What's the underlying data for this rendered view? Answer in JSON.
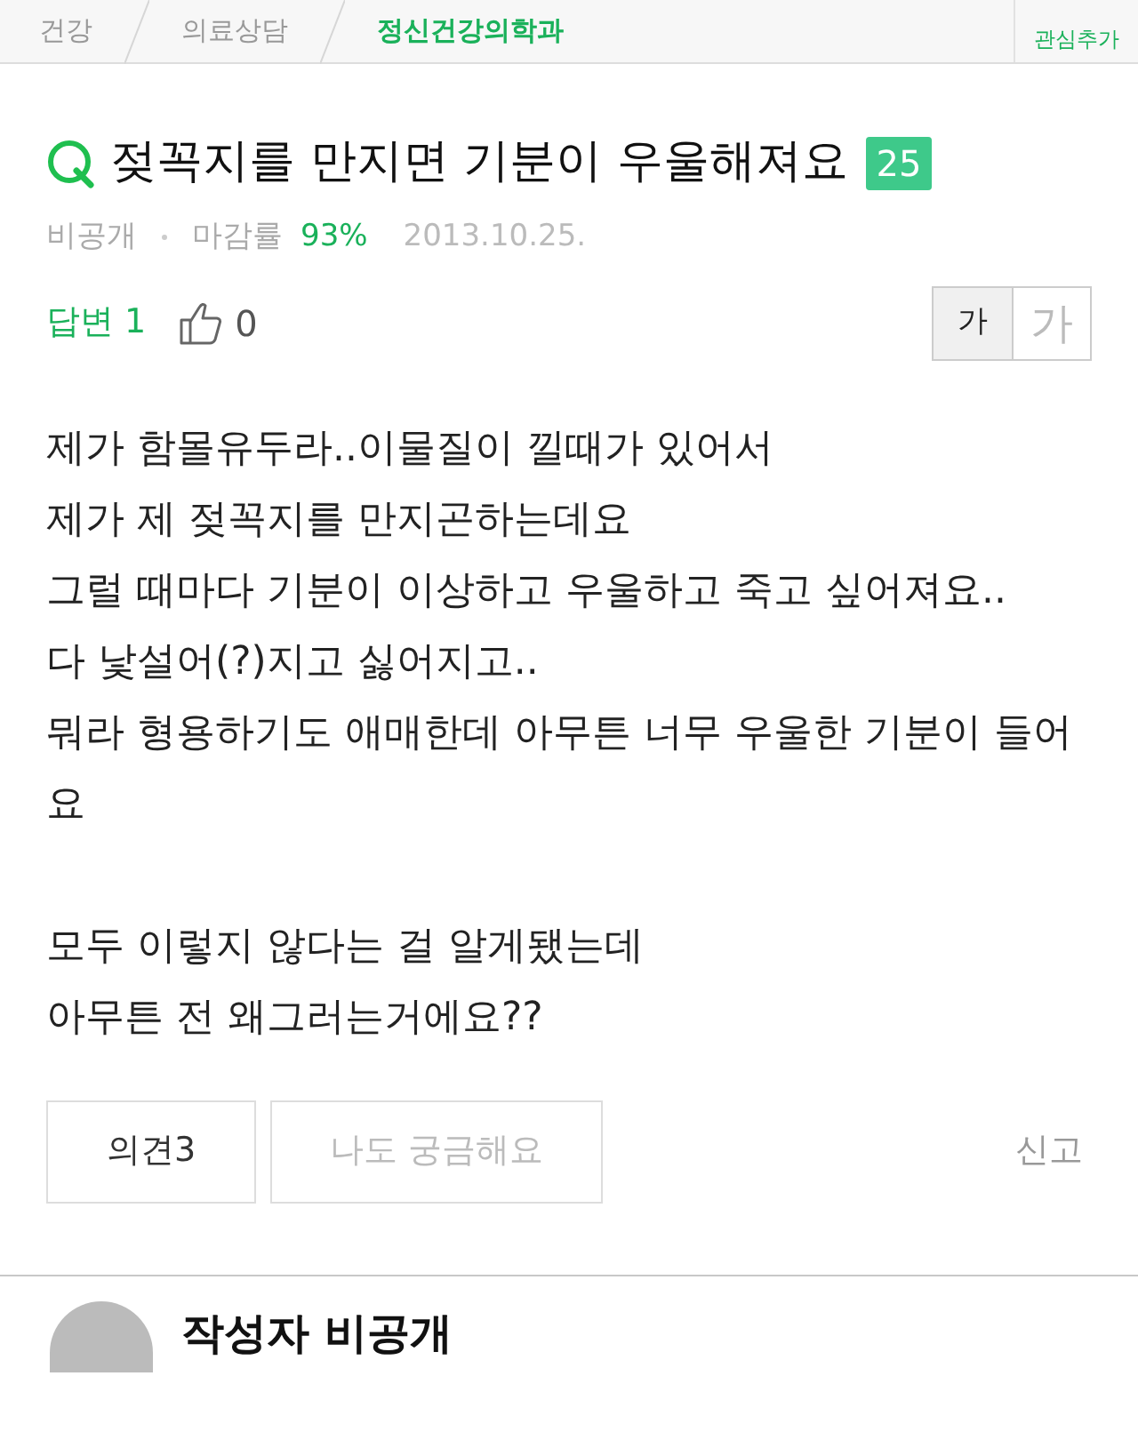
{
  "breadcrumb": [
    {
      "label": "건강",
      "selected": false
    },
    {
      "label": "의료상담",
      "selected": false
    },
    {
      "label": "정신건강의학과",
      "selected": true
    }
  ],
  "interest_button": {
    "label": "관심추가"
  },
  "question": {
    "title": "젖꼭지를 만지면 기분이 우울해져요",
    "points": "25",
    "author": "비공개",
    "close_rate_label": "마감률",
    "close_rate": "93%",
    "date": "2013.10.25."
  },
  "answers": {
    "label": "답변 1",
    "likes": "0"
  },
  "font_size_buttons": [
    {
      "label": "가",
      "selected": true
    },
    {
      "label": "가",
      "selected": false
    }
  ],
  "body": [
    [
      "제가 함몰유두라..이물질이 낄때가 있어서",
      "제가 제 젖꼭지를 만지곤하는데요",
      "그럴 때마다 기분이 이상하고 우울하고 죽고 싶어져요..",
      "다 낯설어(?)지고 싫어지고..",
      "뭐라 형용하기도 애매한데 아무튼 너무 우울한 기분이 들어요"
    ],
    [
      "모두 이렇지 않다는 걸 알게됐는데",
      "아무튼 전 왜그러는거에요??"
    ]
  ],
  "actions": {
    "opinions": "의견3",
    "me_too": "나도 궁금해요",
    "report": "신고"
  },
  "answer_author": {
    "name": "작성자 비공개"
  }
}
